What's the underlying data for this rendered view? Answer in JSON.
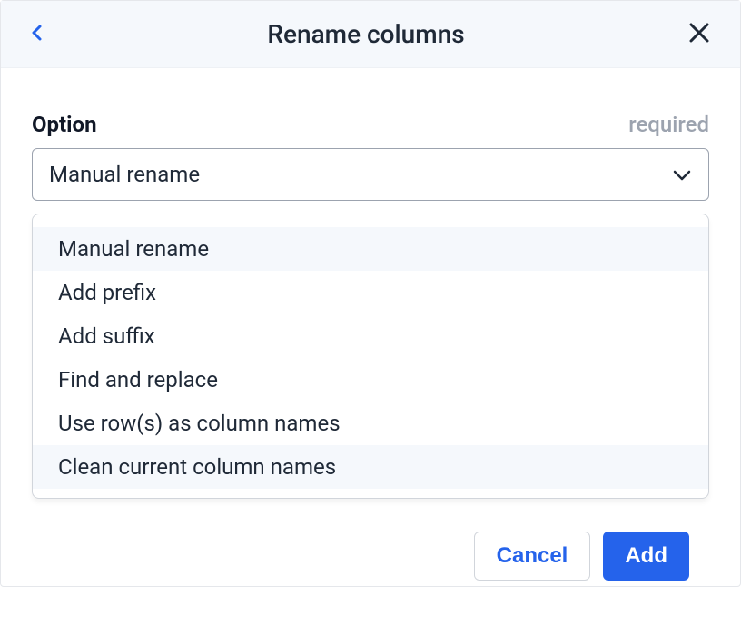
{
  "header": {
    "title": "Rename columns"
  },
  "field": {
    "label": "Option",
    "required_text": "required",
    "selected": "Manual rename"
  },
  "dropdown": {
    "options": [
      {
        "label": "Manual rename",
        "highlighted": true
      },
      {
        "label": "Add prefix",
        "highlighted": false
      },
      {
        "label": "Add suffix",
        "highlighted": false
      },
      {
        "label": "Find and replace",
        "highlighted": false
      },
      {
        "label": "Use row(s) as column names",
        "highlighted": false
      },
      {
        "label": "Clean current column names",
        "highlighted": true
      }
    ]
  },
  "footer": {
    "cancel_label": "Cancel",
    "add_label": "Add"
  }
}
